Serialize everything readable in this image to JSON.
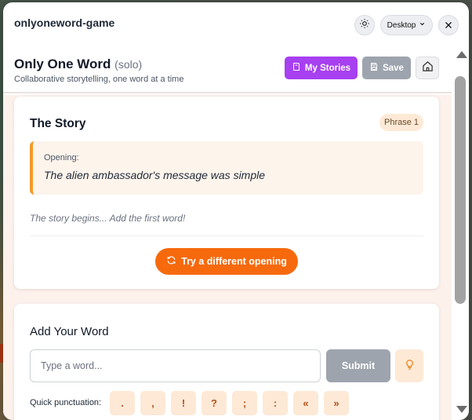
{
  "app": {
    "title": "onlyoneword-game"
  },
  "topbar": {
    "view_mode": "Desktop"
  },
  "header": {
    "title": "Only One Word",
    "mode": "(solo)",
    "subtitle": "Collaborative storytelling, one word at a time",
    "my_stories_label": "My Stories",
    "save_label": "Save"
  },
  "story": {
    "title": "The Story",
    "phrase_badge": "Phrase 1",
    "opening_label": "Opening:",
    "opening_text": "The alien ambassador's message was simple",
    "begins_text": "The story begins... Add the first word!",
    "different_opening_label": "Try a different opening"
  },
  "add_word": {
    "title": "Add Your Word",
    "input_placeholder": "Type a word...",
    "input_value": "",
    "submit_label": "Submit",
    "quick_punctuation_label": "Quick punctuation:",
    "punctuation": [
      ".",
      ",",
      "!",
      "?",
      ";",
      ":",
      "«",
      "»"
    ]
  },
  "colors": {
    "accent_purple": "#a740f0",
    "accent_orange": "#f66a0d",
    "disabled_gray": "#9ea4ae",
    "soft_peach": "#fde9d6"
  }
}
